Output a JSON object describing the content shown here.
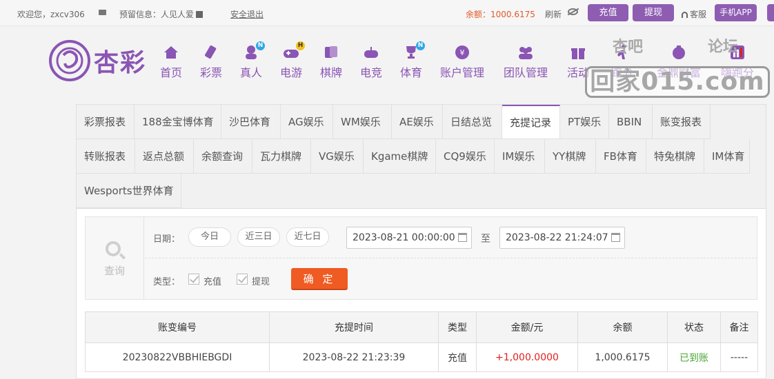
{
  "topbar": {
    "welcome": "欢迎您，zxcv306",
    "reserved": "预留信息：人见人爱",
    "logout": "安全退出",
    "balance": "余额：1000.6175",
    "refresh": "刷新",
    "recharge": "充值",
    "withdraw": "提现",
    "service": "客服",
    "app": "手机APP"
  },
  "brand": {
    "logo_text": "杏彩"
  },
  "nav": [
    {
      "label": "首页",
      "icon": "home-icon"
    },
    {
      "label": "彩票",
      "icon": "lottery-icon"
    },
    {
      "label": "真人",
      "icon": "live-casino-icon",
      "badge": "N"
    },
    {
      "label": "电游",
      "icon": "gamepad-icon",
      "badge": "H"
    },
    {
      "label": "棋牌",
      "icon": "cards-icon"
    },
    {
      "label": "电竞",
      "icon": "esports-icon"
    },
    {
      "label": "体育",
      "icon": "trophy-icon",
      "badge": "N"
    },
    {
      "label": "账户管理",
      "icon": "account-icon"
    },
    {
      "label": "团队管理",
      "icon": "team-icon"
    },
    {
      "label": "活动",
      "icon": "gift-icon"
    },
    {
      "label": "跑分",
      "icon": "running-icon"
    },
    {
      "label": "金鼎财富",
      "icon": "wealth-icon"
    },
    {
      "label": "嗨跑分",
      "icon": "chart-icon"
    }
  ],
  "watermark": {
    "left": "杏吧",
    "right": "论坛",
    "site": "回家015.com"
  },
  "tabs": [
    "彩票报表",
    "188金宝博体育",
    "沙巴体育",
    "AG娱乐",
    "WM娱乐",
    "AE娱乐",
    "日结总览",
    "充提记录",
    "PT娱乐",
    "BBIN",
    "账变报表",
    "转账报表",
    "返点总额",
    "余额查询",
    "瓦力棋牌",
    "VG娱乐",
    "Kgame棋牌",
    "CQ9娱乐",
    "IM娱乐",
    "YY棋牌",
    "FB体育",
    "特兔棋牌",
    "IM体育",
    "Wesports世界体育"
  ],
  "filter": {
    "query": "查询",
    "date_label": "日期：",
    "today": "今日",
    "three_days": "近三日",
    "seven_days": "近七日",
    "start": "2023-08-21 00:00:00",
    "to": "至",
    "end": "2023-08-22 21:24:07",
    "type_label": "类型：",
    "type_recharge": "充值",
    "type_withdraw": "提现",
    "confirm": "确 定"
  },
  "table": {
    "headers": [
      "账变编号",
      "充提时间",
      "类型",
      "金额/元",
      "余额",
      "状态",
      "备注"
    ],
    "rows": [
      [
        "20230822VBBHIEBGDI",
        "2023-08-22 21:23:39",
        "充值",
        "+1,000.0000",
        "1,000.6175",
        "已到账",
        "-----"
      ]
    ]
  }
}
